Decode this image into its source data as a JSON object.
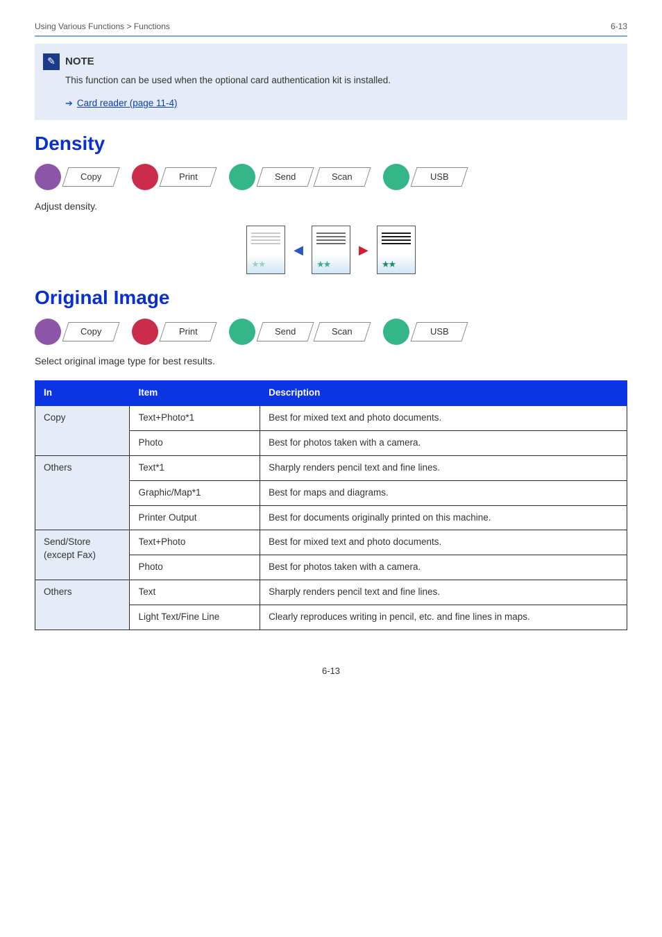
{
  "header": {
    "breadcrumb": "Using Various Functions > Functions",
    "page": "6-13"
  },
  "note": {
    "title": "NOTE",
    "body": "This function can be used when the optional card authentication kit is installed.",
    "link": "Card reader (page 11-4)"
  },
  "density": {
    "heading": "Density",
    "cats": [
      "Copy",
      "Print",
      "Send",
      "Scan",
      "USB"
    ],
    "desc": "Adjust density."
  },
  "original": {
    "heading": "Original Image",
    "cats": [
      "Copy",
      "Print",
      "Send",
      "Scan",
      "USB"
    ],
    "desc": "Select original image type for best results."
  },
  "table": {
    "head": [
      "In",
      "Item",
      "Description"
    ],
    "rows": [
      {
        "cat": "Copy",
        "item": "Text+Photo*1",
        "desc": "Best for mixed text and photo documents.",
        "rs": 2
      },
      {
        "cat": "",
        "item": "Photo",
        "desc": "Best for photos taken with a camera."
      },
      {
        "cat": "Others",
        "item": "Text*1",
        "desc": "Sharply renders pencil text and fine lines.",
        "rs": 3
      },
      {
        "cat": "",
        "item": "Graphic/Map*1",
        "desc": "Best for maps and diagrams."
      },
      {
        "cat": "",
        "item": "Printer Output",
        "desc": "Best for documents originally printed on this machine."
      },
      {
        "cat": "Send/Store (except Fax)",
        "item": "Text+Photo",
        "desc": "Best for mixed text and photo documents.",
        "rs": 2
      },
      {
        "cat": "",
        "item": "Photo",
        "desc": "Best for photos taken with a camera."
      },
      {
        "cat": "Others",
        "item": "Text",
        "desc": "Sharply renders pencil text and fine lines.",
        "rs": 2
      },
      {
        "cat": "",
        "item": "Light Text/Fine Line",
        "desc": "Clearly reproduces writing in pencil, etc. and fine lines in maps."
      }
    ]
  }
}
